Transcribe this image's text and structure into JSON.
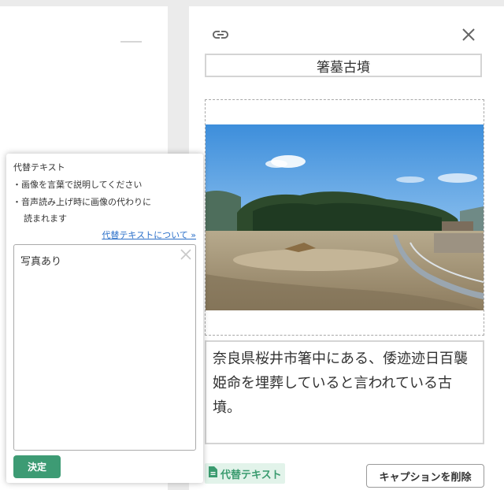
{
  "editor": {
    "title": "箸墓古墳",
    "caption": "奈良県桜井市箸中にある、倭迹迹日百襲姫命を埋葬していると言われている古墳。",
    "alt_badge_label": "代替テキスト",
    "delete_caption_label": "キャプションを削除",
    "icons": {
      "link": "link-icon",
      "close": "close-icon",
      "document": "document-icon"
    }
  },
  "alt_popover": {
    "heading": "代替テキスト",
    "note_1": "・画像を言葉で説明してください",
    "note_2": "・音声読み上げ時に画像の代わりに",
    "note_3": "読まれます",
    "link_label": "代替テキストについて »",
    "value": "写真あり",
    "confirm_label": "決定"
  },
  "colors": {
    "accent_green": "#3d9b74",
    "badge_bg": "#e2f3ea",
    "link_blue": "#2a6fc9"
  }
}
